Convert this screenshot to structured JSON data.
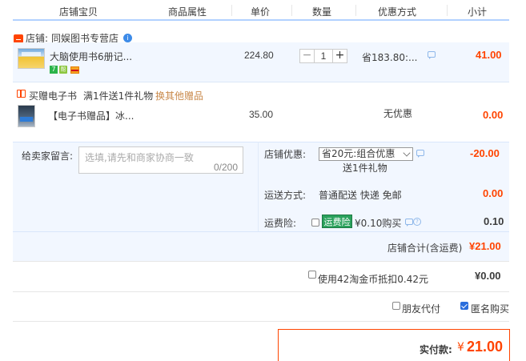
{
  "header": {
    "cols": [
      "店铺宝贝",
      "商品属性",
      "单价",
      "数量",
      "优惠方式",
      "小计"
    ]
  },
  "shop": {
    "label": "店铺:",
    "name": "同娱图书专营店"
  },
  "item1": {
    "title": "大脑使用书6册记...",
    "tag7": "7",
    "tagcert": "帮",
    "price": "224.80",
    "qty": "1",
    "minus": "−",
    "plus": "+",
    "discount": "省183.80:...",
    "subtotal": "41.00"
  },
  "gift": {
    "buy_label": "买赠电子书",
    "rule": "满1件送1件礼物",
    "change_link": "换其他赠品"
  },
  "item2": {
    "title": "【电子书赠品】冰...",
    "price": "35.00",
    "discount": "无优惠",
    "subtotal": "0.00"
  },
  "order": {
    "message_label": "给卖家留言:",
    "message_placeholder": "选填,请先和商家协商一致",
    "message_count": "0/200",
    "shop_discount_label": "店铺优惠:",
    "shop_discount_selected": "省20元:组合优惠",
    "shop_discount_note": "送1件礼物",
    "shop_discount_value": "-20.00",
    "shipping_label": "运送方式:",
    "shipping_method": "普通配送 快递 免邮",
    "shipping_value": "0.00",
    "insurance_label": "运费险:",
    "insurance_badge": "运费险",
    "insurance_price": "¥0.10购买",
    "insurance_value": "0.10",
    "q_icon": "?",
    "total_label": "店铺合计(含运费)",
    "total_value": "¥21.00"
  },
  "coins": {
    "label": "使用42淘金币抵扣0.42元",
    "value": "¥0.00"
  },
  "options": {
    "friend_pay": "朋友代付",
    "friend_pay_checked": false,
    "anonymous": "匿名购买",
    "anonymous_checked": true
  },
  "pay": {
    "label": "实付款:",
    "currency": "¥",
    "amount": "21.00"
  },
  "colors": {
    "accent": "#ff4400",
    "header_line": "#b2d1ff",
    "row_bg": "#f2f7ff",
    "checkbox_blue": "#2a6edc",
    "insurance_green": "#2aa15c"
  }
}
